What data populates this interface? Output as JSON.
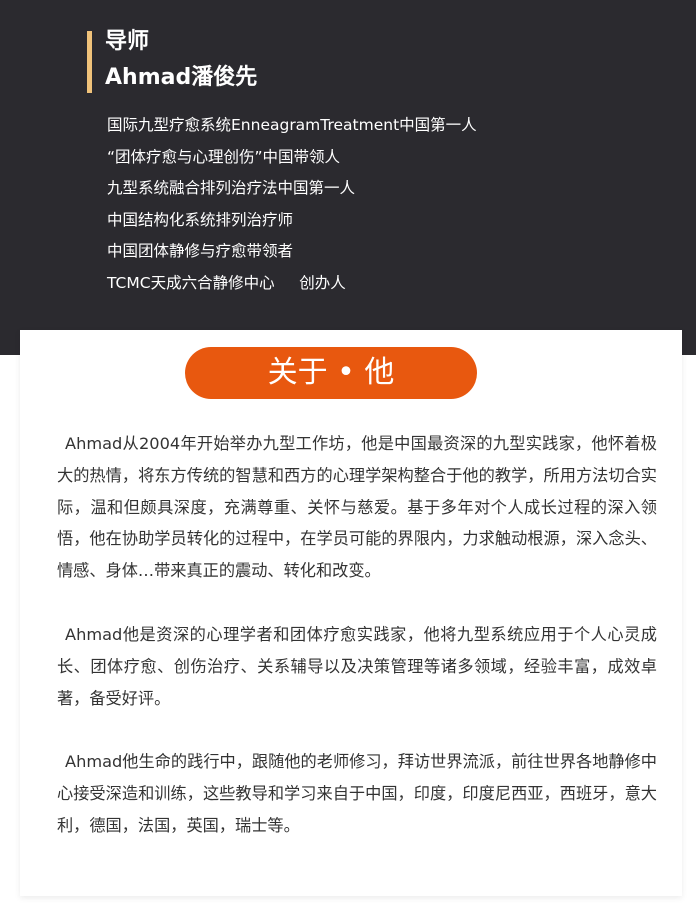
{
  "header": {
    "role": "导师",
    "name": "Ahmad潘俊先",
    "titles": [
      "国际九型疗愈系统EnneagramTreatment中国第一人",
      "“团体疗愈与心理创伤”中国带领人",
      "九型系统融合排列治疗法中国第一人",
      "中国结构化系统排列治疗师",
      "中国团体静修与疗愈带领者",
      "TCMC天成六合静修中心     创办人"
    ]
  },
  "about": {
    "label": "关于 • 他",
    "paragraphs": [
      "Ahmad从2004年开始举办九型工作坊，他是中国最资深的九型实践家，他怀着极大的热情，将东方传统的智慧和西方的心理学架构整合于他的教学，所用方法切合实际，温和但颇具深度，充满尊重、关怀与慈爱。基于多年对个人成长过程的深入领悟，他在协助学员转化的过程中，在学员可能的界限内，力求触动根源，深入念头、情感、身体…带来真正的震动、转化和改变。",
      "Ahmad他是资深的心理学者和团体疗愈实践家，他将九型系统应用于个人心灵成长、团体疗愈、创伤治疗、关系辅导以及决策管理等诸多领域，经验丰富，成效卓著，备受好评。",
      "Ahmad他生命的践行中，跟随他的老师修习，拜访世界流派，前往世界各地静修中心接受深造和训练，这些教导和学习来自于中国，印度，印度尼西亚，西班牙，意大利，德国，法国，英国，瑞士等。"
    ]
  },
  "colors": {
    "header_bg": "#2b2a2f",
    "accent": "#f0c27a",
    "pill": "#e8580f",
    "body_text": "#333333"
  }
}
